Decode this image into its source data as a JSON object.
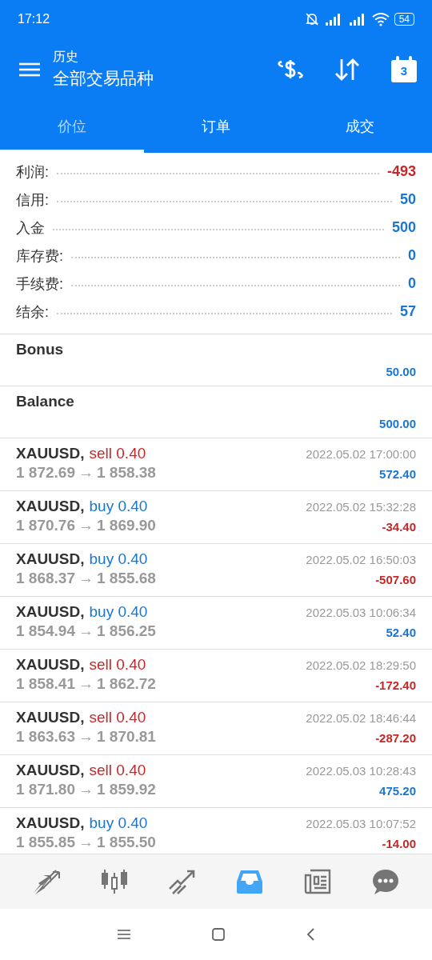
{
  "status_bar": {
    "time": "17:12",
    "battery": "54"
  },
  "app_bar": {
    "subtitle": "历史",
    "title": "全部交易品种",
    "calendar_day": "3"
  },
  "tabs": [
    {
      "label": "价位",
      "selected": true
    },
    {
      "label": "订单",
      "selected": false
    },
    {
      "label": "成交",
      "selected": false
    }
  ],
  "summary": [
    {
      "label": "利润:",
      "value": "-493",
      "color": "#c62828"
    },
    {
      "label": "信用:",
      "value": "50",
      "color": "#1976d2"
    },
    {
      "label": "入金",
      "value": "500",
      "color": "#1976d2"
    },
    {
      "label": "库存费:",
      "value": "0",
      "color": "#1976d2"
    },
    {
      "label": "手续费:",
      "value": "0",
      "color": "#1976d2"
    },
    {
      "label": "结余:",
      "value": "57",
      "color": "#1976d2"
    }
  ],
  "operations": [
    {
      "name": "Bonus",
      "amount": "50.00"
    },
    {
      "name": "Balance",
      "amount": "500.00"
    }
  ],
  "deals": [
    {
      "symbol": "XAUUSD,",
      "kind": "sell",
      "order": "sell 0.40",
      "time": "2022.05.02 17:00:00",
      "open": "1 872.69",
      "arrow": "→",
      "close": "1 858.38",
      "profit": "572.40",
      "color": "#1976d2"
    },
    {
      "symbol": "XAUUSD,",
      "kind": "buy",
      "order": "buy 0.40",
      "time": "2022.05.02 15:32:28",
      "open": "1 870.76",
      "arrow": "→",
      "close": "1 869.90",
      "profit": "-34.40",
      "color": "#c62828"
    },
    {
      "symbol": "XAUUSD,",
      "kind": "buy",
      "order": "buy 0.40",
      "time": "2022.05.02 16:50:03",
      "open": "1 868.37",
      "arrow": "→",
      "close": "1 855.68",
      "profit": "-507.60",
      "color": "#c62828"
    },
    {
      "symbol": "XAUUSD,",
      "kind": "buy",
      "order": "buy 0.40",
      "time": "2022.05.03 10:06:34",
      "open": "1 854.94",
      "arrow": "→",
      "close": "1 856.25",
      "profit": "52.40",
      "color": "#1976d2"
    },
    {
      "symbol": "XAUUSD,",
      "kind": "sell",
      "order": "sell 0.40",
      "time": "2022.05.02 18:29:50",
      "open": "1 858.41",
      "arrow": "→",
      "close": "1 862.72",
      "profit": "-172.40",
      "color": "#c62828"
    },
    {
      "symbol": "XAUUSD,",
      "kind": "sell",
      "order": "sell 0.40",
      "time": "2022.05.02 18:46:44",
      "open": "1 863.63",
      "arrow": "→",
      "close": "1 870.81",
      "profit": "-287.20",
      "color": "#c62828"
    },
    {
      "symbol": "XAUUSD,",
      "kind": "sell",
      "order": "sell 0.40",
      "time": "2022.05.03 10:28:43",
      "open": "1 871.80",
      "arrow": "→",
      "close": "1 859.92",
      "profit": "475.20",
      "color": "#1976d2"
    },
    {
      "symbol": "XAUUSD,",
      "kind": "buy",
      "order": "buy 0.40",
      "time": "2022.05.03 10:07:52",
      "open": "1 855.85",
      "arrow": "→",
      "close": "1 855.50",
      "profit": "-14.00",
      "color": "#c62828"
    }
  ],
  "bottom_nav": [
    {
      "kind": "quotes",
      "selected": false
    },
    {
      "kind": "chart",
      "selected": false
    },
    {
      "kind": "trade",
      "selected": false
    },
    {
      "kind": "history",
      "selected": true
    },
    {
      "kind": "news",
      "selected": false
    },
    {
      "kind": "chat",
      "selected": false
    }
  ]
}
